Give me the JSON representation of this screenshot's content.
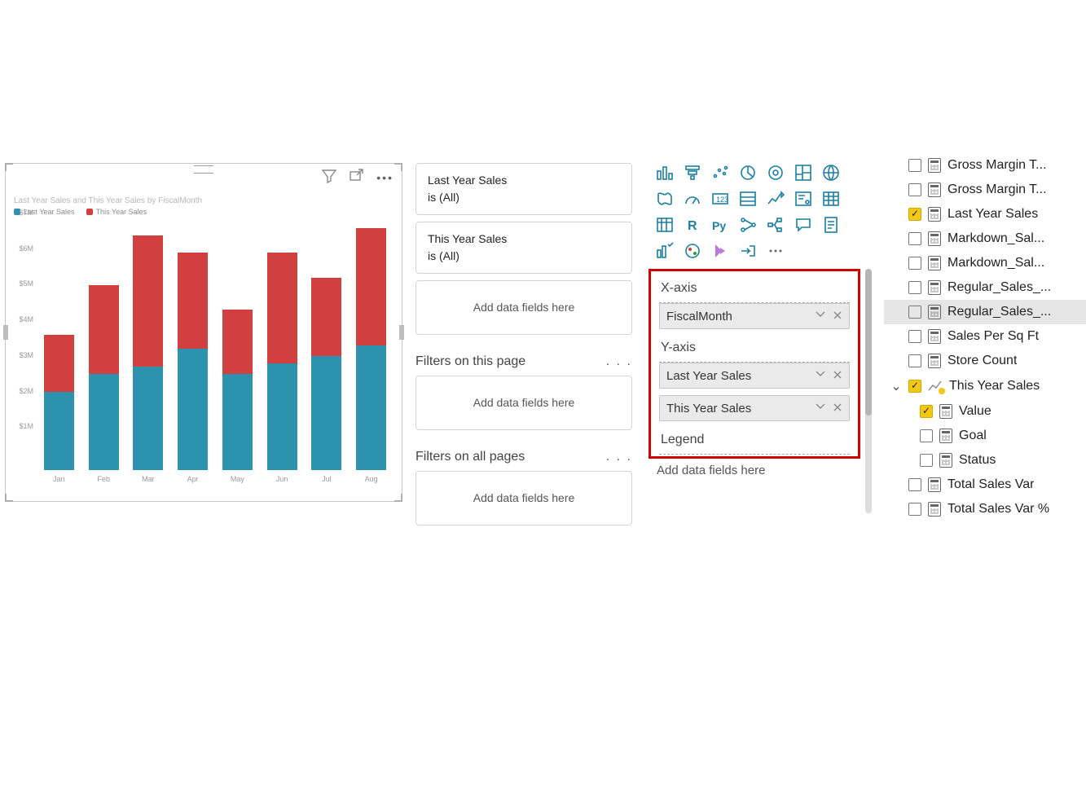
{
  "chart_data": {
    "type": "bar",
    "title": "Last Year Sales and This Year Sales by FiscalMonth",
    "legend": [
      "Last Year Sales",
      "This Year Sales"
    ],
    "categories": [
      "Jan",
      "Feb",
      "Mar",
      "Apr",
      "May",
      "Jun",
      "Jul",
      "Aug"
    ],
    "series": [
      {
        "name": "Last Year Sales",
        "color": "#2c92ad",
        "values": [
          2.2,
          2.7,
          2.9,
          3.4,
          2.7,
          3.0,
          3.2,
          3.5
        ]
      },
      {
        "name": "This Year Sales",
        "color": "#d13f3f",
        "values": [
          1.6,
          2.5,
          3.7,
          2.7,
          1.8,
          3.1,
          2.2,
          3.3
        ]
      }
    ],
    "ylabel": "",
    "xlabel": "",
    "ylim": [
      0,
      7
    ],
    "yticks": [
      "$1M",
      "$2M",
      "$3M",
      "$4M",
      "$5M",
      "$6M",
      "$7M"
    ]
  },
  "filters": {
    "cards": [
      {
        "name": "Last Year Sales",
        "state": "is (All)"
      },
      {
        "name": "This Year Sales",
        "state": "is (All)"
      }
    ],
    "add": "Add data fields here",
    "page_head": "Filters on this page",
    "all_head": "Filters on all pages"
  },
  "wells": {
    "xaxis_label": "X-axis",
    "xaxis_items": [
      "FiscalMonth"
    ],
    "yaxis_label": "Y-axis",
    "yaxis_items": [
      "Last Year Sales",
      "This Year Sales"
    ],
    "legend_label": "Legend",
    "legend_drop": "Add data fields here"
  },
  "viz_icons": [
    "clustered-column",
    "funnel",
    "scatter",
    "pie",
    "donut",
    "treemap",
    "map",
    "filled-map",
    "gauge",
    "card",
    "multirow-card",
    "kpi",
    "slicer",
    "table",
    "matrix",
    "r-visual",
    "py-visual",
    "key-influencers",
    "decomposition",
    "qna",
    "paginated",
    "smart-narrative",
    "arcgis",
    "powerapps",
    "automate",
    "more"
  ],
  "fields": [
    {
      "label": "Gross Margin T...",
      "checked": false,
      "icon": "calc"
    },
    {
      "label": "Gross Margin T...",
      "checked": false,
      "icon": "calc"
    },
    {
      "label": "Last Year Sales",
      "checked": true,
      "icon": "calc"
    },
    {
      "label": "Markdown_Sal...",
      "checked": false,
      "icon": "calc"
    },
    {
      "label": "Markdown_Sal...",
      "checked": false,
      "icon": "calc"
    },
    {
      "label": "Regular_Sales_...",
      "checked": false,
      "icon": "calc"
    },
    {
      "label": "Regular_Sales_...",
      "checked": false,
      "icon": "calc",
      "selected": true
    },
    {
      "label": "Sales Per Sq Ft",
      "checked": false,
      "icon": "calc"
    },
    {
      "label": "Store Count",
      "checked": false,
      "icon": "calc"
    },
    {
      "label": "This Year Sales",
      "checked": true,
      "icon": "trend",
      "expandable": true,
      "expanded": true,
      "badge": true
    },
    {
      "label": "Value",
      "checked": true,
      "icon": "calc",
      "child": true
    },
    {
      "label": "Goal",
      "checked": false,
      "icon": "calc",
      "child": true
    },
    {
      "label": "Status",
      "checked": false,
      "icon": "calc",
      "child": true
    },
    {
      "label": "Total Sales Var",
      "checked": false,
      "icon": "calc"
    },
    {
      "label": "Total Sales Var %",
      "checked": false,
      "icon": "calc"
    }
  ]
}
